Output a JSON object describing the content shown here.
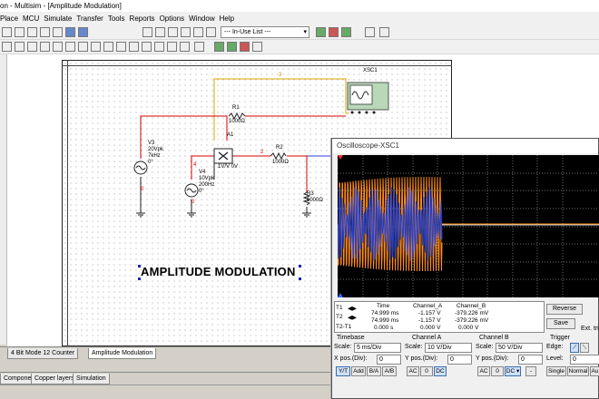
{
  "window": {
    "title": "on - Multisim - [Amplitude Modulation]"
  },
  "menu": [
    "Place",
    "MCU",
    "Simulate",
    "Transfer",
    "Tools",
    "Reports",
    "Options",
    "Window",
    "Help"
  ],
  "toolbar": {
    "in_use_list": "--- In-Use List ---"
  },
  "circuit": {
    "title_label": "AMPLITUDE MODULATION",
    "v3": {
      "name": "V3",
      "amp": "20Vpk",
      "freq": "7kHz",
      "phase": "0°"
    },
    "v4": {
      "name": "V4",
      "amp": "10Vpk",
      "freq": "200Hz",
      "phase": "0°"
    },
    "r1": {
      "name": "R1",
      "value": "1000Ω"
    },
    "r2": {
      "name": "R2",
      "value": "1000Ω"
    },
    "r3": {
      "name": "R3",
      "value": "1000Ω"
    },
    "a1": {
      "name": "A1",
      "spec": "1V/V 0V"
    },
    "xsc": "XSC1",
    "nets": {
      "n0a": "0",
      "n0b": "0",
      "n2": "2",
      "n3": "3",
      "n4": "4"
    }
  },
  "tabs": {
    "design1": "4 Bit Mode 12 Counter",
    "design2": "Amplitude Modulation"
  },
  "bottom_tabs": {
    "components": "Components",
    "copper": "Copper layers",
    "simulation": "Simulation"
  },
  "oscilloscope": {
    "title": "Oscilloscope-XSC1",
    "readout": {
      "headers": {
        "time": "Time",
        "cha": "Channel_A",
        "chb": "Channel_B"
      },
      "t1": {
        "label": "T1",
        "time": "74.999 ms",
        "a": "-1.157 V",
        "b": "-379.226 mV"
      },
      "t2": {
        "label": "T2",
        "time": "74.999 ms",
        "a": "-1.157 V",
        "b": "-379.226 mV"
      },
      "diff": {
        "label": "T2-T1",
        "time": "0.000 s",
        "a": "0.000 V",
        "b": "0.000 V"
      }
    },
    "buttons": {
      "reverse": "Reverse",
      "save": "Save",
      "ext_trigger": "Ext. tri"
    },
    "timebase": {
      "label": "Timebase",
      "scale_label": "Scale:",
      "scale": "5 ms/Div",
      "xpos_label": "X pos.(Div):",
      "xpos": "0",
      "modes": [
        "Y/T",
        "Add",
        "B/A",
        "A/B"
      ]
    },
    "channel_a": {
      "label": "Channel A",
      "scale_label": "Scale:",
      "scale": "10  V/Div",
      "ypos_label": "Y pos.(Div):",
      "ypos": "0",
      "coupling": [
        "AC",
        "0",
        "DC"
      ]
    },
    "channel_b": {
      "label": "Channel B",
      "scale_label": "Scale:",
      "scale": "50  V/Div",
      "ypos_label": "Y pos.(Div):",
      "ypos": "0",
      "coupling": [
        "AC",
        "0",
        "DC"
      ],
      "extra": "-"
    },
    "trigger": {
      "label": "Trigger",
      "edge_label": "Edge:",
      "level_label": "Level:",
      "level": "0",
      "modes": [
        "Single",
        "Normal",
        "Au"
      ]
    },
    "colors": {
      "channel_a": "#ff8c1a",
      "channel_b": "#1f3fd6",
      "screen": "#000000",
      "grid": "#6b6b6b"
    }
  }
}
